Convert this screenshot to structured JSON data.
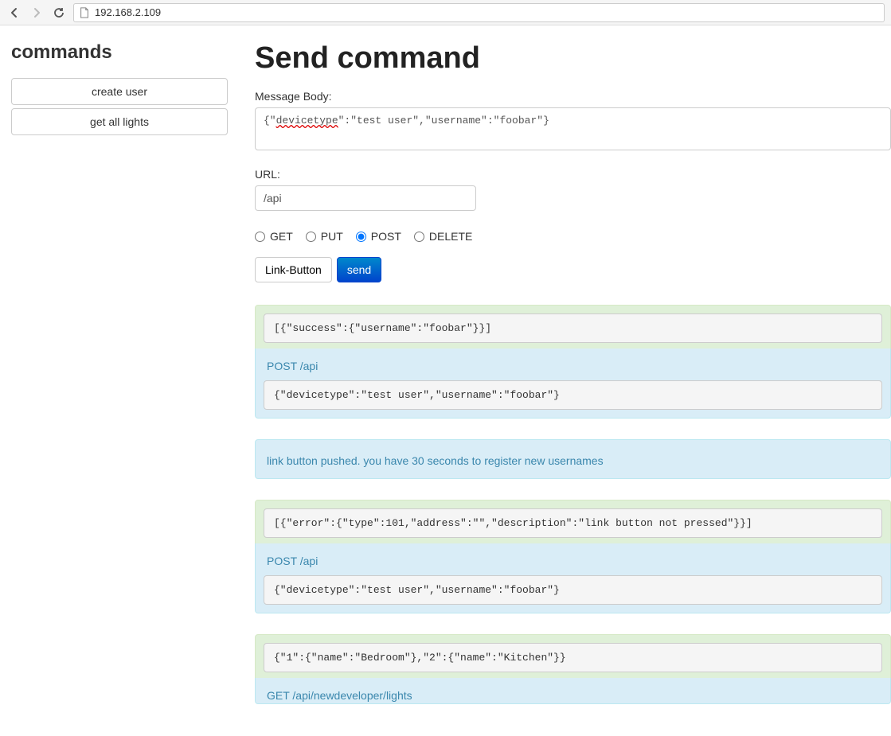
{
  "browser": {
    "address": "192.168.2.109"
  },
  "sidebar": {
    "title": "commands",
    "items": [
      {
        "label": "create user"
      },
      {
        "label": "get all lights"
      }
    ]
  },
  "main": {
    "title": "Send command",
    "message_body_label": "Message Body:",
    "message_body_value": "{\"devicetype\":\"test user\",\"username\":\"foobar\"}",
    "url_label": "URL:",
    "url_value": "/api",
    "methods": {
      "get": "GET",
      "put": "PUT",
      "post": "POST",
      "delete": "DELETE",
      "selected": "post"
    },
    "link_button_label": "Link-Button",
    "send_label": "send"
  },
  "results": [
    {
      "type": "pair",
      "response": "[{\"success\":{\"username\":\"foobar\"}}]",
      "request_title": "POST /api",
      "request_body": "{\"devicetype\":\"test user\",\"username\":\"foobar\"}"
    },
    {
      "type": "note",
      "message": "link button pushed. you have 30 seconds to register new usernames"
    },
    {
      "type": "pair",
      "response": "[{\"error\":{\"type\":101,\"address\":\"\",\"description\":\"link button not pressed\"}}]",
      "request_title": "POST /api",
      "request_body": "{\"devicetype\":\"test user\",\"username\":\"foobar\"}"
    },
    {
      "type": "pair",
      "response": "{\"1\":{\"name\":\"Bedroom\"},\"2\":{\"name\":\"Kitchen\"}}",
      "request_title": "GET /api/newdeveloper/lights",
      "request_body": ""
    }
  ]
}
